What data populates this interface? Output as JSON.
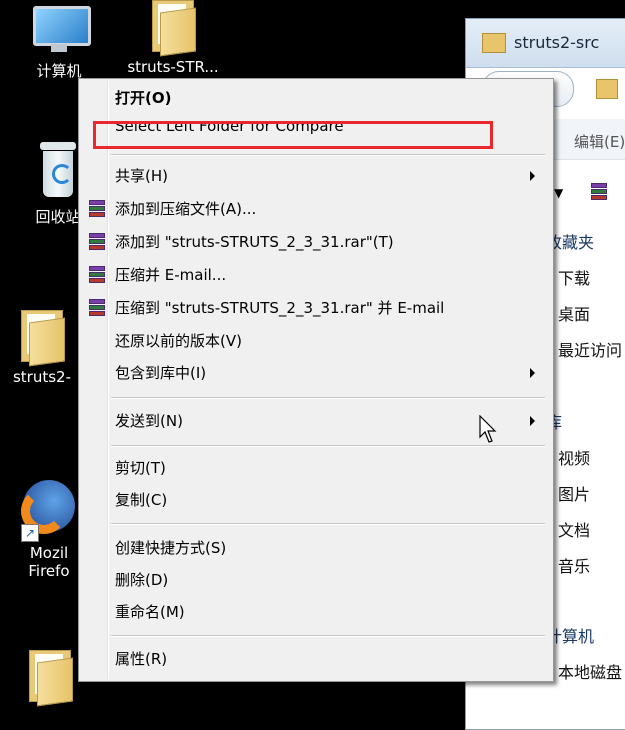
{
  "desktop": {
    "icons": [
      {
        "label": "计算机"
      },
      {
        "label": "struts-STR..."
      },
      {
        "label": "回收站"
      },
      {
        "label": "struts2-"
      },
      {
        "label": "Mozil"
      },
      {
        "label": "Firefo"
      }
    ]
  },
  "explorer": {
    "title": "struts2-src",
    "menu_edit": "编辑(E)",
    "nav_items": [
      "收藏夹",
      "下载",
      "桌面",
      "最近访问",
      "库",
      "视频",
      "图片",
      "文档",
      "音乐",
      "计算机",
      "本地磁盘"
    ]
  },
  "context_menu": {
    "items": [
      {
        "label": "打开(O)"
      },
      {
        "label": "Select Left Folder for Compare"
      },
      {
        "label": "共享(H)"
      },
      {
        "label": "添加到压缩文件(A)..."
      },
      {
        "label": "添加到 \"struts-STRUTS_2_3_31.rar\"(T)"
      },
      {
        "label": "压缩并 E-mail..."
      },
      {
        "label": "压缩到 \"struts-STRUTS_2_3_31.rar\" 并 E-mail"
      },
      {
        "label": "还原以前的版本(V)"
      },
      {
        "label": "包含到库中(I)"
      },
      {
        "label": "发送到(N)"
      },
      {
        "label": "剪切(T)"
      },
      {
        "label": "复制(C)"
      },
      {
        "label": "创建快捷方式(S)"
      },
      {
        "label": "删除(D)"
      },
      {
        "label": "重命名(M)"
      },
      {
        "label": "属性(R)"
      }
    ]
  },
  "colors": {
    "highlight_border": "#e8282d",
    "menu_background": "#f0f0f0",
    "desktop_background": "#000000"
  }
}
